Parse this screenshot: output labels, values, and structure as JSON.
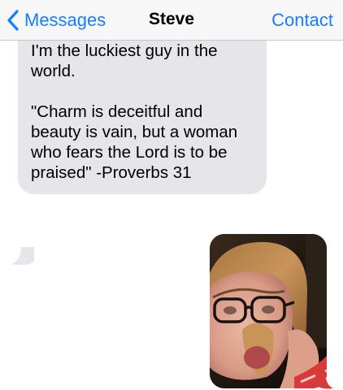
{
  "nav": {
    "back_label": "Messages",
    "title": "Steve",
    "contact_label": "Contact"
  },
  "messages": [
    {
      "direction": "incoming",
      "paragraphs": [
        "I'm the luckiest guy in the world.",
        "\"Charm is deceitful and beauty is vain, but a woman who fears the Lord is to be praised\" -Proverbs 31"
      ]
    },
    {
      "direction": "outgoing",
      "type": "photo"
    }
  ],
  "colors": {
    "accent": "#147efb",
    "incoming_bubble": "#e5e5ea",
    "navbar_bg": "#f7f7f8"
  },
  "icons": {
    "back": "chevron-left-icon"
  }
}
